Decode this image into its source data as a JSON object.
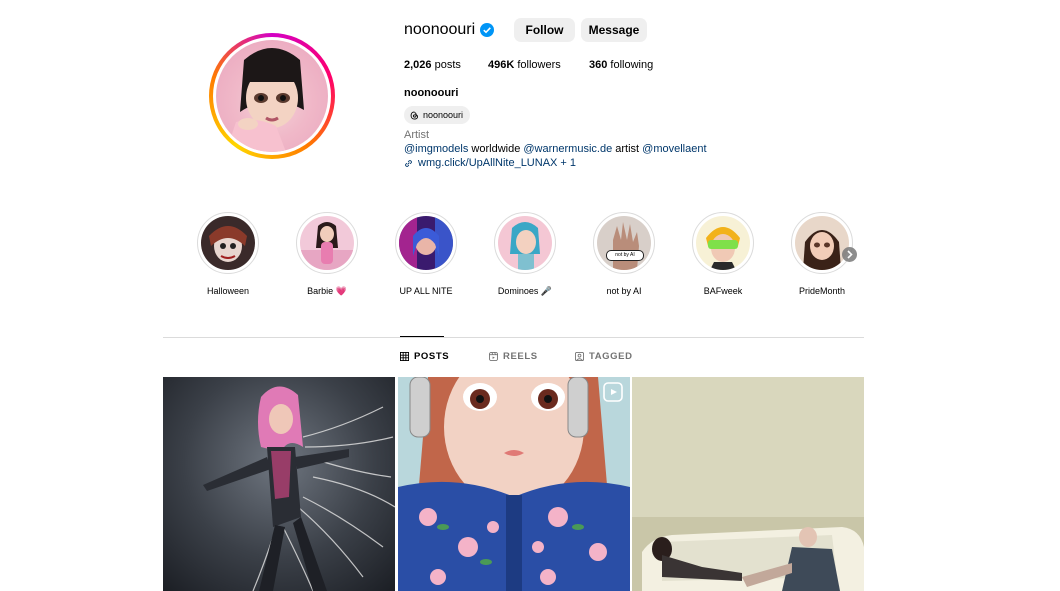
{
  "profile": {
    "username": "noonoouri",
    "follow_label": "Follow",
    "message_label": "Message",
    "posts_count": "2,026",
    "posts_label": "posts",
    "followers_count": "496K",
    "followers_label": "followers",
    "following_count": "360",
    "following_label": "following",
    "full_name": "noonoouri",
    "threads_handle": "noonoouri",
    "category": "Artist",
    "bio_mention_1": "@imgmodels",
    "bio_text_1": " worldwide ",
    "bio_mention_2": "@warnermusic.de",
    "bio_text_2": " artist ",
    "bio_mention_3": "@movellaent",
    "link_text": "wmg.click/UpAllNite_LUNAX + 1"
  },
  "highlights": [
    {
      "label": "Halloween"
    },
    {
      "label": "Barbie 💗"
    },
    {
      "label": "UP ALL NITE"
    },
    {
      "label": "Dominoes 🎤"
    },
    {
      "label": "not by AI"
    },
    {
      "label": "BAFweek"
    },
    {
      "label": "PrideMonth"
    }
  ],
  "tabs": {
    "posts": "POSTS",
    "reels": "REELS",
    "tagged": "TAGGED"
  },
  "badge_not_by_ai": "not by AI",
  "colors": {
    "verified": "#0095f6",
    "link": "#00376b",
    "button_bg": "#efefef",
    "muted": "#737373"
  }
}
